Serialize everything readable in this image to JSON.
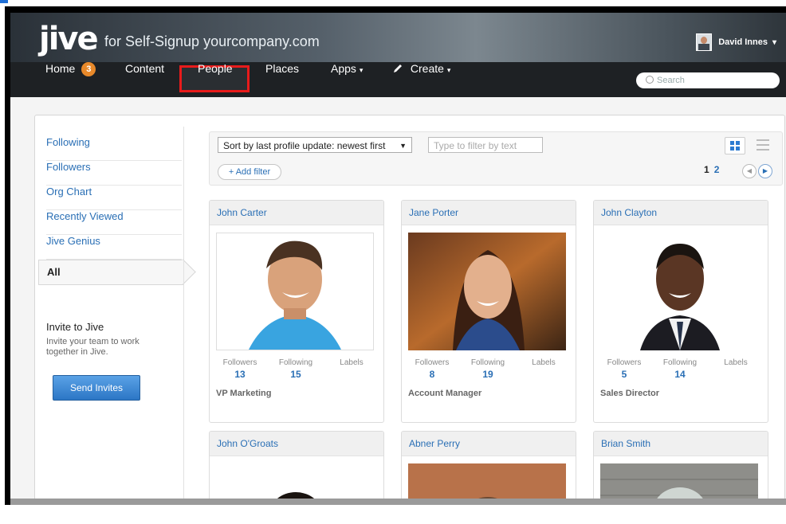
{
  "brand": {
    "logo": "jive",
    "tagline": "for Self-Signup yourcompany.com"
  },
  "user": {
    "name": "David Innes",
    "caret": "▾"
  },
  "nav": {
    "items": [
      {
        "label": "Home",
        "badge": "3"
      },
      {
        "label": "Content"
      },
      {
        "label": "People"
      },
      {
        "label": "Places"
      },
      {
        "label": "Apps",
        "caret": "▾"
      },
      {
        "label": "Create",
        "caret": "▾"
      }
    ],
    "search_placeholder": "Search"
  },
  "sidebar": {
    "items": [
      "Following",
      "Followers",
      "Org Chart",
      "Recently Viewed",
      "Jive Genius",
      "All"
    ],
    "invite_title": "Invite to Jive",
    "invite_desc": "Invite your team to work together in Jive.",
    "invite_button": "Send Invites"
  },
  "filters": {
    "sort_selected": "Sort by last profile update: newest first",
    "filter_placeholder": "Type to filter by text",
    "add_filter": "+ Add filter",
    "page_current": "1",
    "page_next": "2"
  },
  "stat_labels": {
    "followers": "Followers",
    "following": "Following",
    "labels": "Labels"
  },
  "people": [
    {
      "name": "John Carter",
      "followers": "13",
      "following": "15",
      "role": "VP Marketing"
    },
    {
      "name": "Jane Porter",
      "followers": "8",
      "following": "19",
      "role": "Account Manager"
    },
    {
      "name": "John Clayton",
      "followers": "5",
      "following": "14",
      "role": "Sales Director"
    },
    {
      "name": "John O'Groats"
    },
    {
      "name": "Abner Perry"
    },
    {
      "name": "Brian Smith"
    }
  ],
  "colors": {
    "accent": "#2a6fb5",
    "badge": "#e8892a",
    "highlight": "#e81b1b",
    "nav": "#1e2124"
  }
}
